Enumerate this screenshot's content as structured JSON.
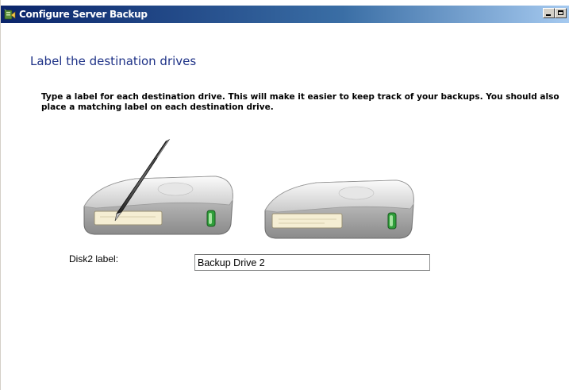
{
  "window": {
    "title": "Configure Server Backup"
  },
  "page": {
    "heading": "Label the destination drives",
    "instructions": "Type a label for each destination drive. This will make it easier to keep track of your backups. You should also place a matching label on each destination drive."
  },
  "disk": {
    "label": "Disk2 label:",
    "value": "Backup Drive 2"
  },
  "icons": {
    "app": "server-backup-icon",
    "drive_with_pen": "hard-drive-pen-icon",
    "drive": "hard-drive-icon"
  },
  "colors": {
    "heading": "#1e3287",
    "titlebar_start": "#0a246a",
    "titlebar_end": "#a6caf0"
  }
}
